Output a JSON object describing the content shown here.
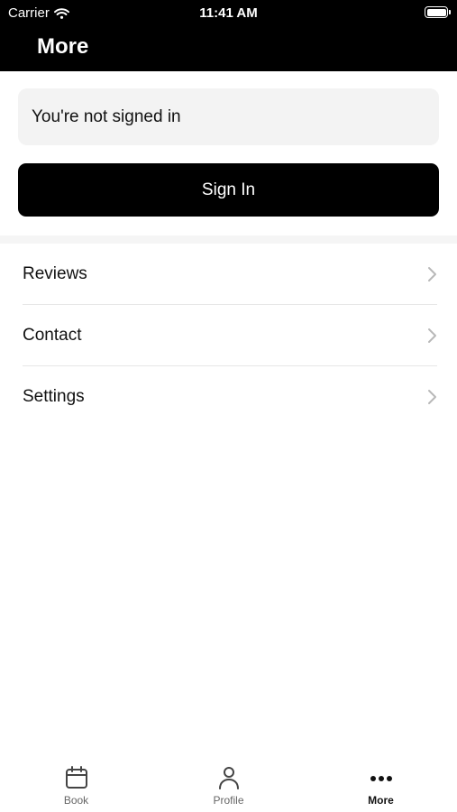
{
  "status_bar": {
    "carrier": "Carrier",
    "time": "11:41 AM"
  },
  "header": {
    "title": "More"
  },
  "auth": {
    "notice": "You're not signed in",
    "sign_in_label": "Sign In"
  },
  "menu": {
    "items": [
      {
        "label": "Reviews"
      },
      {
        "label": "Contact"
      },
      {
        "label": "Settings"
      }
    ]
  },
  "tab_bar": {
    "tabs": [
      {
        "label": "Book",
        "icon": "calendar-icon"
      },
      {
        "label": "Profile",
        "icon": "person-icon"
      },
      {
        "label": "More",
        "icon": "ellipsis-icon",
        "active": true
      }
    ]
  },
  "colors": {
    "header_bg": "#000000",
    "button_bg": "#000000",
    "notice_bg": "#f3f3f3",
    "accent_text": "#111111"
  }
}
